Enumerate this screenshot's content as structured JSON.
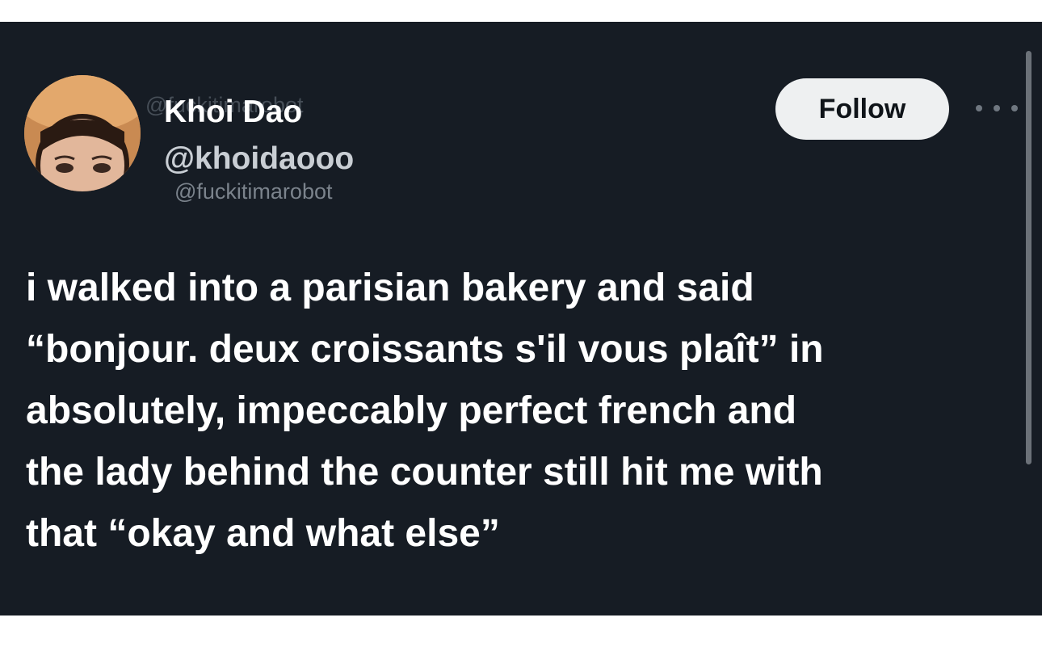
{
  "tweet": {
    "author": {
      "display_name": "Khoi Dao",
      "handle": "@khoidaooo",
      "avatar_icon": "profile-photo"
    },
    "watermark": {
      "top": "@fuckitimarobot",
      "bottom": "@fuckitimarobot"
    },
    "follow_label": "Follow",
    "more_icon": "more-options-icon",
    "text_lines": [
      "i walked into a parisian bakery and said",
      "“bonjour. deux croissants s'il vous plaît” in",
      "absolutely, impeccably perfect french and",
      "the lady behind the counter still hit me with",
      "that “okay and what else”"
    ]
  },
  "colors": {
    "background": "#161c24",
    "text": "#ffffff",
    "handle": "#c9ced4",
    "follow_bg": "#eef0f1"
  }
}
